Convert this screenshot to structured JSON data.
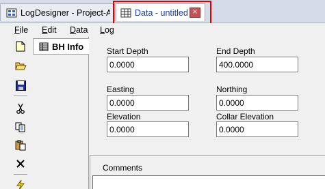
{
  "tabs": {
    "project": {
      "label": "LogDesigner - Project-A",
      "icon": "app-icon"
    },
    "data": {
      "label": "Data - untitled",
      "icon": "data-grid-icon",
      "close_glyph": "×"
    }
  },
  "menu": [
    {
      "label": "File",
      "mnemonic": "F",
      "rest": "ile"
    },
    {
      "label": "Edit",
      "mnemonic": "E",
      "rest": "dit"
    },
    {
      "label": "Data",
      "mnemonic": "D",
      "rest": "ata"
    },
    {
      "label": "Log",
      "mnemonic": "L",
      "rest": "og"
    }
  ],
  "toolbar": {
    "icons": [
      "new-file-icon",
      "open-folder-icon",
      "save-icon",
      "cut-icon",
      "copy-icon",
      "paste-icon",
      "delete-icon",
      "run-icon"
    ]
  },
  "page_tab": {
    "label": "BH Info",
    "icon": "borehole-icon"
  },
  "fields": {
    "start_depth": {
      "label": "Start Depth",
      "value": "0.0000"
    },
    "end_depth": {
      "label": "End Depth",
      "value": "400.0000"
    },
    "easting": {
      "label": "Easting",
      "value": "0.0000"
    },
    "northing": {
      "label": "Northing",
      "value": "0.0000"
    },
    "elevation": {
      "label": "Elevation",
      "value": "0.0000"
    },
    "collar_elevation": {
      "label": "Collar Elevation",
      "value": "0.0000"
    }
  },
  "comments": {
    "label": "Comments",
    "value": ""
  },
  "colors": {
    "highlight": "#e00000",
    "active_tab_text": "#1a3d99",
    "close_button": "#c75050"
  }
}
